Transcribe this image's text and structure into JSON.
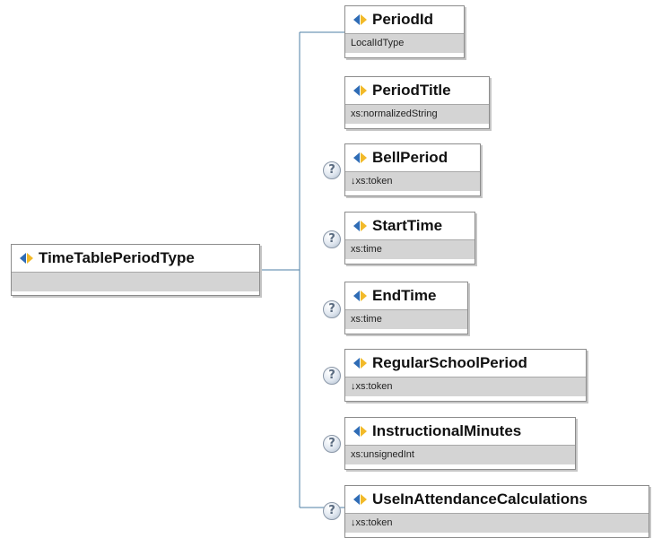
{
  "root": {
    "name": "TimeTablePeriodType",
    "type": ""
  },
  "children": [
    {
      "name": "PeriodId",
      "type": "LocalIdType",
      "optional": false
    },
    {
      "name": "PeriodTitle",
      "type": "xs:normalizedString",
      "optional": false
    },
    {
      "name": "BellPeriod",
      "type": "↓xs:token",
      "optional": true
    },
    {
      "name": "StartTime",
      "type": "xs:time",
      "optional": true
    },
    {
      "name": "EndTime",
      "type": "xs:time",
      "optional": true
    },
    {
      "name": "RegularSchoolPeriod",
      "type": "↓xs:token",
      "optional": true
    },
    {
      "name": "InstructionalMinutes",
      "type": "xs:unsignedInt",
      "optional": true
    },
    {
      "name": "UseInAttendanceCalculations",
      "type": "↓xs:token",
      "optional": true
    }
  ],
  "colors": {
    "connector": "#4d7fa6",
    "border": "#8c8c8c",
    "type_band": "#d4d4d4",
    "icon_blue": "#2f6cb5",
    "icon_gold": "#f2b928"
  },
  "icons": {
    "element": "element-icon",
    "optional": "help-icon"
  }
}
